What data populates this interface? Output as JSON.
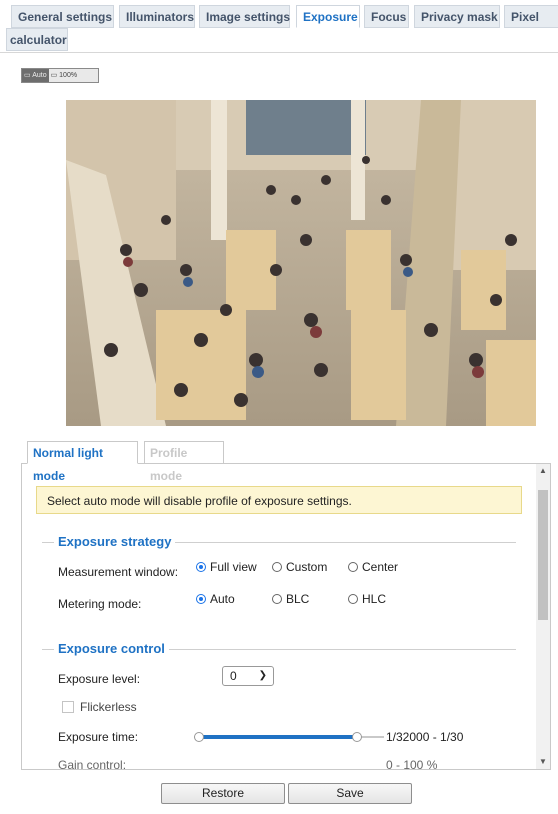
{
  "tabs": [
    "General settings",
    "Illuminators",
    "Image settings",
    "Exposure",
    "Focus",
    "Privacy mask",
    "Pixel",
    "calculator"
  ],
  "view_toggle": {
    "auto": "Auto",
    "zoom": "100%"
  },
  "sub_tabs": [
    "Normal light mode",
    "Profile mode"
  ],
  "notice": "Select auto mode will disable profile of exposure settings.",
  "strategy": {
    "title": "Exposure strategy",
    "measurement_label": "Measurement window:",
    "measurement_options": [
      "Full view",
      "Custom",
      "Center"
    ],
    "measurement_selected": "Full view",
    "metering_label": "Metering mode:",
    "metering_options": [
      "Auto",
      "BLC",
      "HLC"
    ],
    "metering_selected": "Auto"
  },
  "control": {
    "title": "Exposure control",
    "level_label": "Exposure level:",
    "level_value": "0",
    "flickerless_label": "Flickerless",
    "time_label": "Exposure time:",
    "time_range": "1/32000 - 1/30",
    "time_slider": {
      "low_fraction": 0.0,
      "high_fraction": 0.88
    },
    "gain_label": "Gain control:",
    "gain_range": "0 - 100 %"
  },
  "buttons": {
    "restore": "Restore",
    "save": "Save"
  },
  "colors": {
    "accent": "#1f72c4",
    "notice_bg": "#fdf6d3"
  }
}
